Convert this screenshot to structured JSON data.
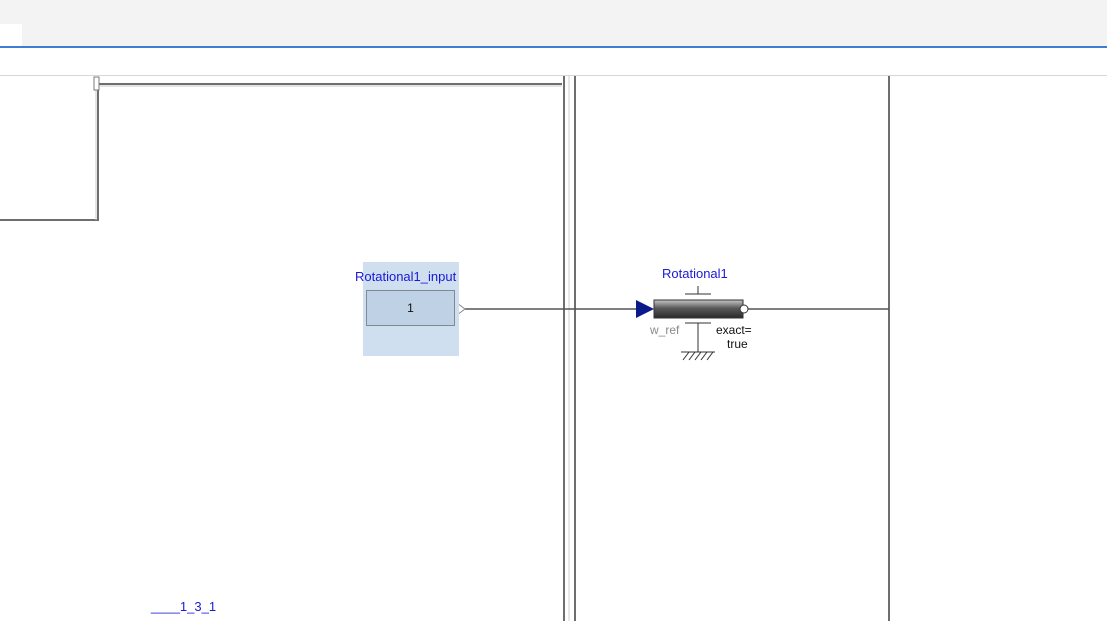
{
  "tabbar": {
    "active_tab_label": ":"
  },
  "diagram": {
    "constant_block": {
      "name": "Rotational1_input",
      "value": "1"
    },
    "rotational_block": {
      "name": "Rotational1",
      "input_label": "w_ref",
      "param_label": "exact=",
      "param_value": "true"
    },
    "subsystem_link_label": "____1_3_1"
  },
  "colors": {
    "label_blue": "#1a1ad6",
    "highlight": "#cfdff0",
    "tab_accent": "#3d7ed0"
  }
}
